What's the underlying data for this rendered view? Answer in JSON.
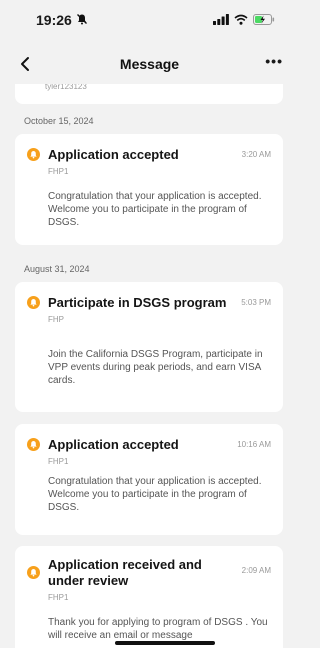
{
  "status_bar": {
    "time": "19:26"
  },
  "nav": {
    "title": "Message",
    "more": "•••"
  },
  "partial_top": {
    "sub": "tyler123123"
  },
  "groups": [
    {
      "date": "October 15, 2024"
    },
    {
      "date": "August 31, 2024"
    }
  ],
  "messages": [
    {
      "title": "Application accepted",
      "time": "3:20 AM",
      "sub": "FHP1",
      "body": "Congratulation that your application is accepted. Welcome you to participate in the program of DSGS."
    },
    {
      "title": "Participate in  DSGS program",
      "time": "5:03 PM",
      "sub": "FHP",
      "body": "Join the California DSGS Program, participate in VPP events during peak periods, and earn VISA cards."
    },
    {
      "title": "Application accepted",
      "time": "10:16 AM",
      "sub": "FHP1",
      "body": "Congratulation that your application is accepted. Welcome you to participate in the program of DSGS."
    },
    {
      "title": "Application received and under review",
      "time": "2:09 AM",
      "sub": "FHP1",
      "body": "Thank you for applying to program of DSGS . You will receive an email or message"
    }
  ],
  "colors": {
    "accent": "#f7a01b",
    "background": "#f2f2f2",
    "card": "#ffffff"
  }
}
